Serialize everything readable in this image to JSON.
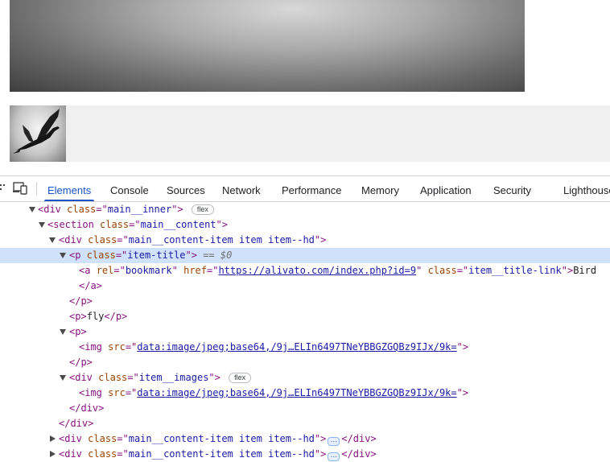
{
  "page": {
    "hero_image": "hero-photo",
    "thumbnail": "bird-flying-thumbnail"
  },
  "devtools": {
    "tabs": [
      "Elements",
      "Console",
      "Sources",
      "Network",
      "Performance",
      "Memory",
      "Application",
      "Security",
      "Lighthouse"
    ],
    "active_tab": "Elements",
    "icons": [
      "inspect-element-icon",
      "device-toolbar-icon"
    ],
    "colors": {
      "active_tab": "#1a53c4",
      "selected_row": "#cfe1fb",
      "tag": "#881280",
      "attr_name": "#994500",
      "attr_value": "#1a1aa6"
    },
    "tree": {
      "r0": {
        "open": "<div",
        "attr": "class",
        "eq": "=\"",
        "val": "main__inner",
        "close": "\">",
        "badge": "flex"
      },
      "r1": {
        "open": "<section",
        "attr": "class",
        "eq": "=\"",
        "val": "main__content",
        "close": "\">"
      },
      "r2": {
        "open": "<div",
        "attr": "class",
        "eq": "=\"",
        "val": "main__content-item item item--hd",
        "close": "\">"
      },
      "r3": {
        "open": "<p",
        "attr": "class",
        "eq": "=\"",
        "val": "item-title",
        "close": "\">",
        "marker": "== $0"
      },
      "r4": {
        "open": "<a",
        "a1": "rel",
        "v1": "bookmark",
        "a2": "href",
        "v2": "https://alivato.com/index.php?id=9",
        "a3": "class",
        "v3": "item__title-link",
        "close": ">",
        "text": "Bird"
      },
      "r5": {
        "close_tag": "</a>"
      },
      "r6": {
        "close_tag": "</p>"
      },
      "r7": {
        "open": "<p>",
        "text": "fly",
        "close_tag": "</p>"
      },
      "r8": {
        "open": "<p>"
      },
      "r9": {
        "open": "<img",
        "attr": "src",
        "eq": "=\"",
        "val": "data:image/jpeg;base64,/9j…ELIn6497TNeYBBGZGQBz9IJx/9k=",
        "close": "\">"
      },
      "r10": {
        "close_tag": "</p>"
      },
      "r11": {
        "open": "<div",
        "attr": "class",
        "eq": "=\"",
        "val": "item__images",
        "close": "\">",
        "badge": "flex"
      },
      "r12": {
        "open": "<img",
        "attr": "src",
        "eq": "=\"",
        "val": "data:image/jpeg;base64,/9j…ELIn6497TNeYBBGZGQBz9IJx/9k=",
        "close": "\">"
      },
      "r13": {
        "close_tag": "</div>"
      },
      "r14": {
        "close_tag": "</div>"
      },
      "r15": {
        "open": "<div",
        "attr": "class",
        "eq": "=\"",
        "val": "main__content-item item item--hd",
        "close": "\">",
        "ellipsis": "…",
        "close_tag": "</div>"
      },
      "r16": {
        "open": "<div",
        "attr": "class",
        "eq": "=\"",
        "val": "main__content-item item item--hd",
        "close": "\">",
        "ellipsis": "…",
        "close_tag": "</div>"
      }
    }
  }
}
